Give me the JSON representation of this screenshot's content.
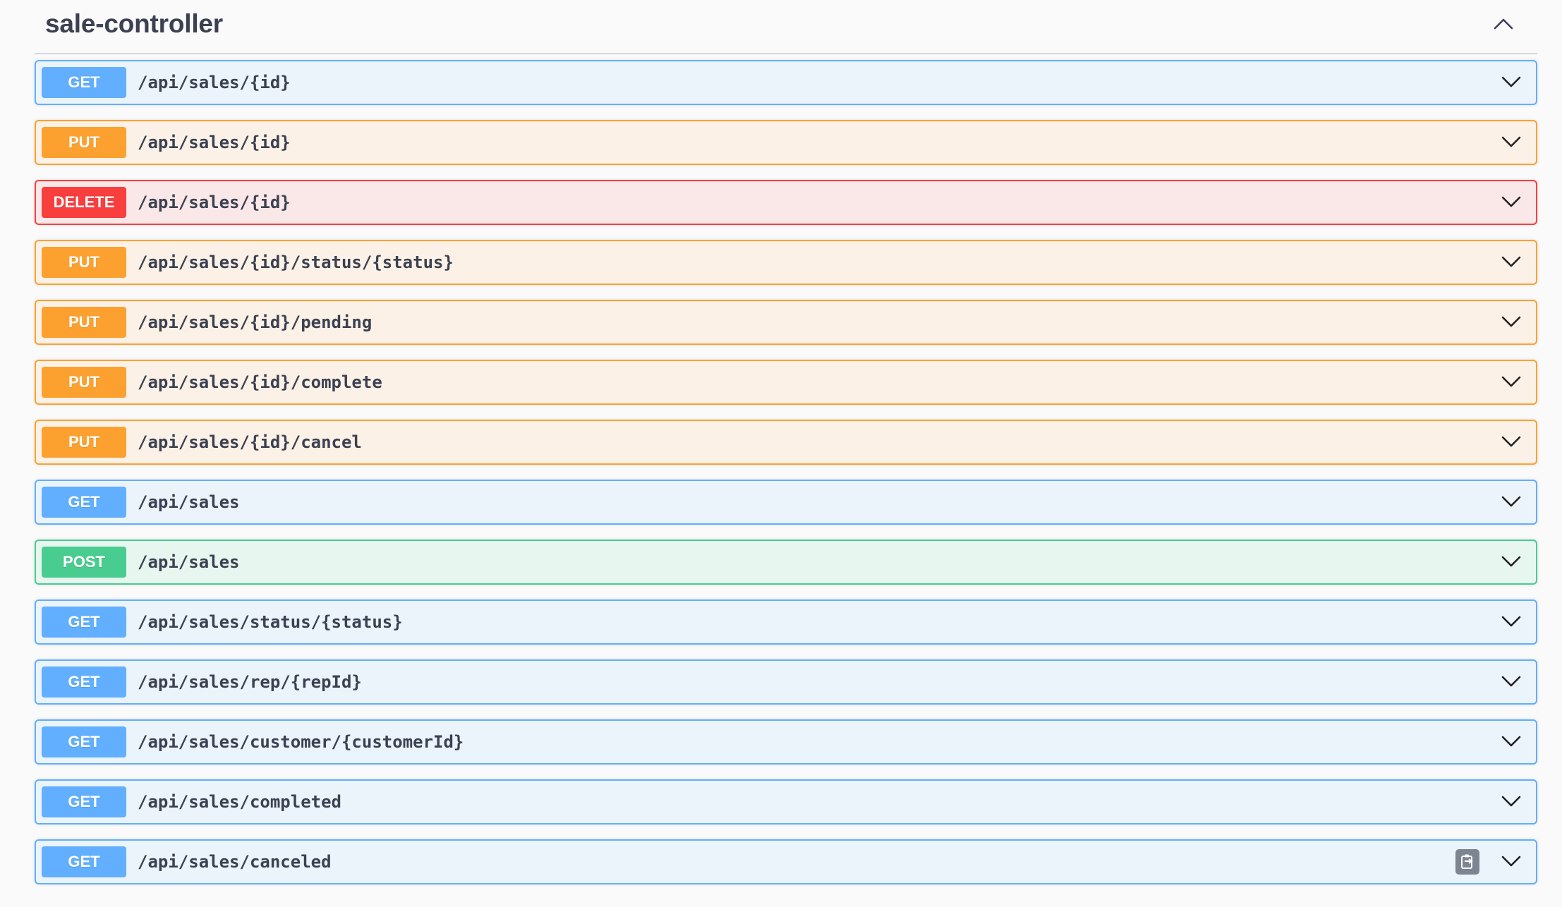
{
  "section": {
    "title": "sale-controller",
    "collapse_icon": "chevron-up-icon"
  },
  "operations": [
    {
      "method": "GET",
      "path": "/api/sales/{id}",
      "type": "get"
    },
    {
      "method": "PUT",
      "path": "/api/sales/{id}",
      "type": "put"
    },
    {
      "method": "DELETE",
      "path": "/api/sales/{id}",
      "type": "delete"
    },
    {
      "method": "PUT",
      "path": "/api/sales/{id}/status/{status}",
      "type": "put"
    },
    {
      "method": "PUT",
      "path": "/api/sales/{id}/pending",
      "type": "put"
    },
    {
      "method": "PUT",
      "path": "/api/sales/{id}/complete",
      "type": "put"
    },
    {
      "method": "PUT",
      "path": "/api/sales/{id}/cancel",
      "type": "put"
    },
    {
      "method": "GET",
      "path": "/api/sales",
      "type": "get"
    },
    {
      "method": "POST",
      "path": "/api/sales",
      "type": "post"
    },
    {
      "method": "GET",
      "path": "/api/sales/status/{status}",
      "type": "get"
    },
    {
      "method": "GET",
      "path": "/api/sales/rep/{repId}",
      "type": "get"
    },
    {
      "method": "GET",
      "path": "/api/sales/customer/{customerId}",
      "type": "get"
    },
    {
      "method": "GET",
      "path": "/api/sales/completed",
      "type": "get"
    },
    {
      "method": "GET",
      "path": "/api/sales/canceled",
      "type": "get",
      "has_copy_button": true
    }
  ],
  "colors": {
    "get": "#61affe",
    "put": "#fca130",
    "delete": "#f93e3e",
    "post": "#49cc90",
    "text": "#3b4151"
  },
  "icons": {
    "expand": "chevron-down-icon",
    "copy": "copy-icon"
  }
}
